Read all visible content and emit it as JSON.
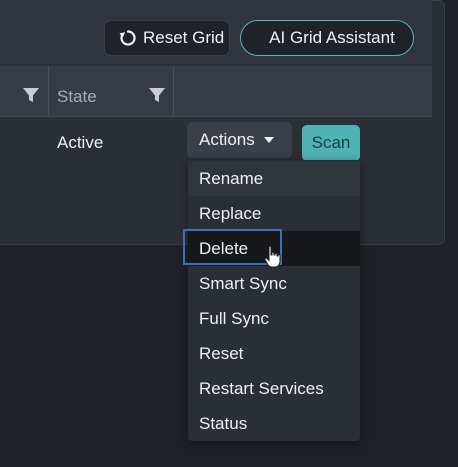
{
  "toolbar": {
    "reset_grid_label": "Reset Grid",
    "ai_assistant_label": "AI Grid Assistant"
  },
  "grid": {
    "columns": [
      {
        "label": "",
        "filter_icon": "filter-icon"
      },
      {
        "label": "State",
        "filter_icon": "filter-icon"
      }
    ],
    "rows": [
      {
        "state": "Active",
        "actions_label": "Actions",
        "scan_label": "Scan"
      }
    ]
  },
  "actions_menu": {
    "items": [
      "Rename",
      "Replace",
      "Delete",
      "Smart Sync",
      "Full Sync",
      "Reset",
      "Restart Services",
      "Status"
    ],
    "highlighted_item": "Delete"
  },
  "colors": {
    "background": "#1e2126",
    "panel": "#2a2e35",
    "header": "#363b44",
    "accent_teal": "#4fb2b4",
    "focus_blue": "#3e6fbf"
  }
}
